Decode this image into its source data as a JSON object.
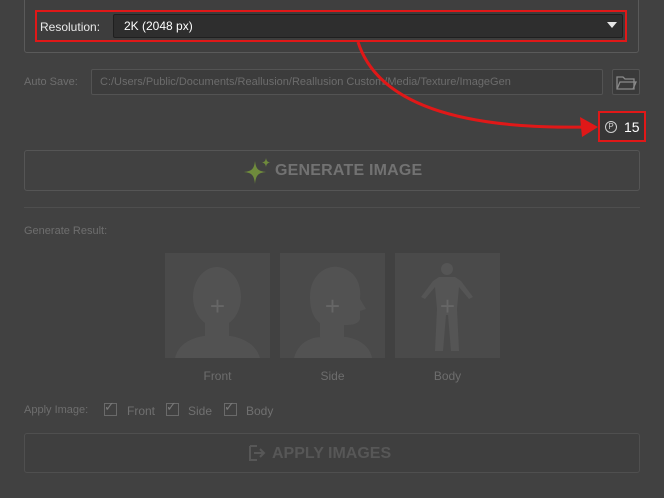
{
  "resolution": {
    "label": "Resolution:",
    "value": "2K (2048 px)"
  },
  "auto_save": {
    "label": "Auto Save:",
    "path": "C:/Users/Public/Documents/Reallusion/Reallusion Custom/Media/Texture/ImageGen"
  },
  "points": {
    "value": "15",
    "icon_glyph": "P"
  },
  "generate": {
    "label": "GENERATE IMAGE"
  },
  "generate_result": {
    "label": "Generate Result:"
  },
  "thumbnails": [
    {
      "label": "Front"
    },
    {
      "label": "Side"
    },
    {
      "label": "Body"
    }
  ],
  "apply_image": {
    "label": "Apply Image:",
    "options": [
      {
        "label": "Front",
        "checked": true
      },
      {
        "label": "Side",
        "checked": true
      },
      {
        "label": "Body",
        "checked": true
      }
    ]
  },
  "apply": {
    "label": "APPLY IMAGES"
  },
  "colors": {
    "highlight": "#e01818",
    "background": "#414141",
    "sparkle": "#6f8b3c"
  }
}
